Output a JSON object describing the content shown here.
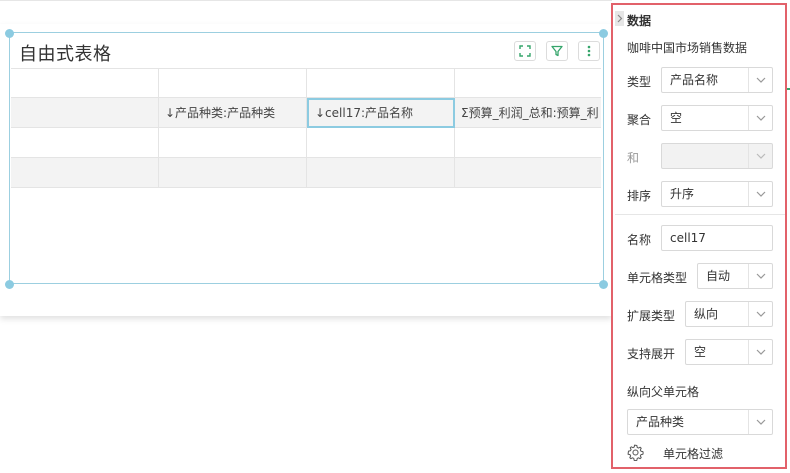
{
  "widget": {
    "title": "自由式表格",
    "toolbar_icons": [
      "fullscreen-icon",
      "filter-icon",
      "more-icon"
    ],
    "accent_color": "#35a56b",
    "table": {
      "rows": [
        [
          "",
          "",
          "",
          ""
        ],
        [
          "",
          "↓产品种类:产品种类",
          "↓cell17:产品名称",
          "Σ预算_利润_总和:预算_利"
        ],
        [
          "",
          "",
          "",
          ""
        ],
        [
          "",
          "",
          "",
          ""
        ]
      ]
    }
  },
  "panel": {
    "section_title": "数据",
    "collapse_icon": "chevron-right-icon",
    "dataset_name": "咖啡中国市场销售数据",
    "type": {
      "label": "类型",
      "value": "产品名称"
    },
    "aggregate": {
      "label": "聚合",
      "value": "空"
    },
    "sum": {
      "label": "和",
      "value": ""
    },
    "sort": {
      "label": "排序",
      "value": "升序"
    },
    "name": {
      "label": "名称",
      "value": "cell17"
    },
    "cell_type": {
      "label": "单元格类型",
      "value": "自动"
    },
    "expand_type": {
      "label": "扩展类型",
      "value": "纵向"
    },
    "support_expand": {
      "label": "支持展开",
      "value": "空"
    },
    "parent_cell": {
      "label": "纵向父单元格",
      "value": "产品种类"
    },
    "cell_filter": {
      "label": "单元格过滤",
      "icon": "gear-icon"
    },
    "highlight_color": "#e2616a"
  }
}
